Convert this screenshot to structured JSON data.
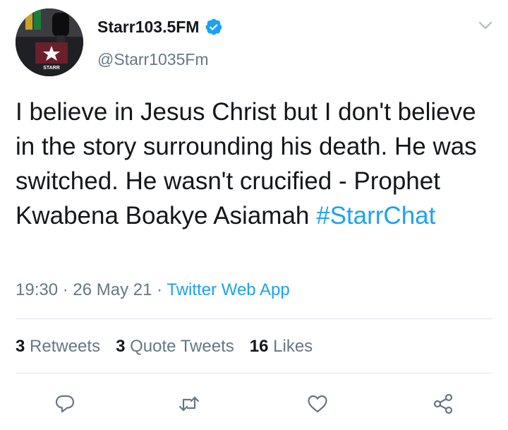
{
  "author": {
    "display_name": "Starr103.5FM",
    "handle": "@Starr1035Fm",
    "verified": true,
    "avatar_logo_text": "STARR"
  },
  "tweet": {
    "text": "I believe in Jesus Christ but I don't believe in the story surrounding his death. He was switched. He wasn't crucified - Prophet Kwabena Boakye Asiamah",
    "hashtag": "#StarrChat",
    "time": "19:30",
    "separator": "·",
    "date": "26 May 21",
    "source": "Twitter Web App"
  },
  "stats": {
    "retweets_count": "3",
    "retweets_label": "Retweets",
    "quotes_count": "3",
    "quotes_label": "Quote Tweets",
    "likes_count": "16",
    "likes_label": "Likes"
  },
  "colors": {
    "accent": "#1da1f2",
    "text": "#14171a",
    "secondary": "#657786",
    "divider": "#dce3e8"
  },
  "icons": [
    "verified-badge-icon",
    "chevron-down-icon",
    "reply-icon",
    "retweet-icon",
    "like-icon",
    "share-icon"
  ]
}
